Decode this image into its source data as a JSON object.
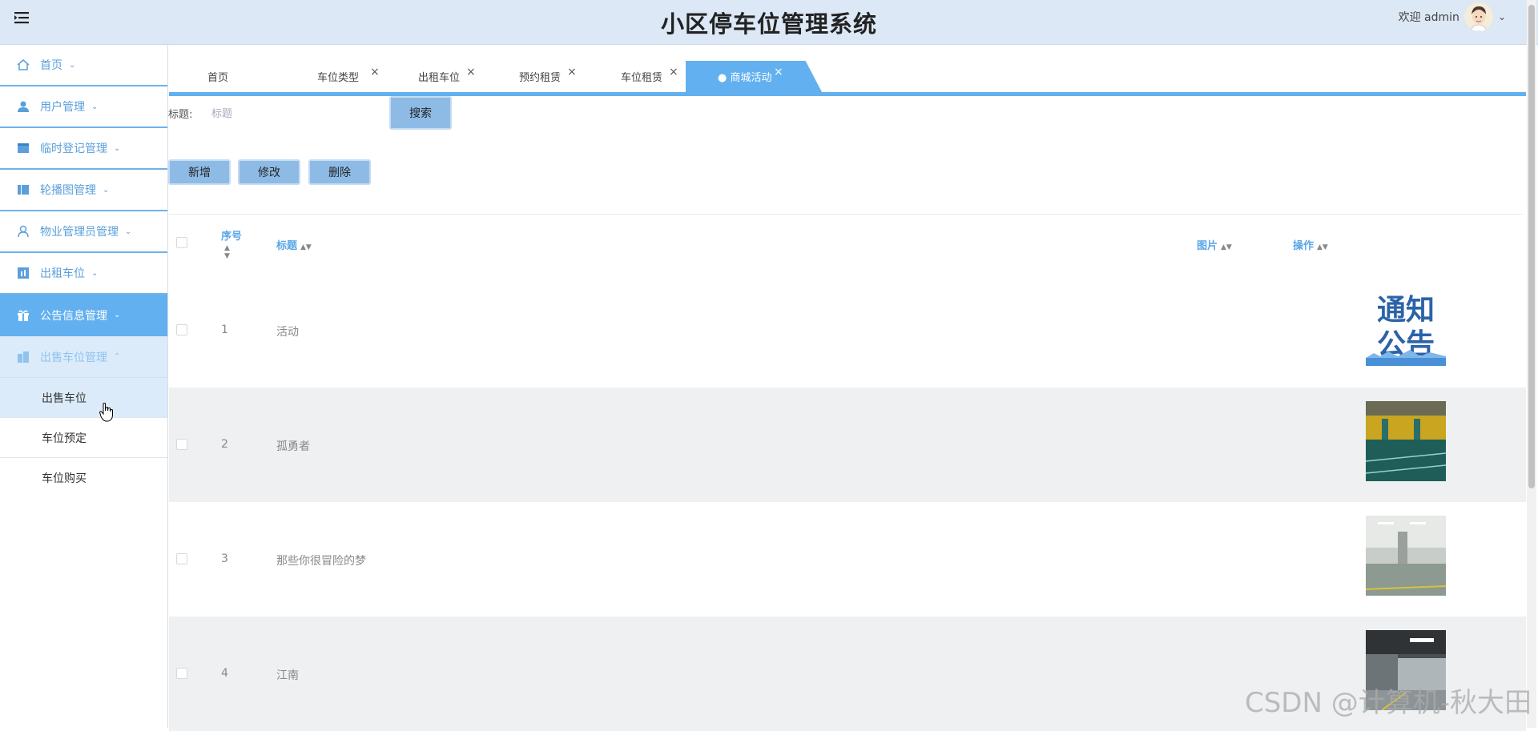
{
  "header": {
    "title": "小区停车位管理系统",
    "welcome": "欢迎 admin"
  },
  "sidebar": {
    "items": [
      {
        "label": "首页",
        "icon": "home-icon",
        "state": "normal"
      },
      {
        "label": "用户管理",
        "icon": "user-icon",
        "state": "normal"
      },
      {
        "label": "临时登记管理",
        "icon": "form-icon",
        "state": "normal"
      },
      {
        "label": "轮播图管理",
        "icon": "carousel-icon",
        "state": "normal"
      },
      {
        "label": "物业管理员管理",
        "icon": "person-outline-icon",
        "state": "normal"
      },
      {
        "label": "出租车位",
        "icon": "chart-icon",
        "state": "normal"
      },
      {
        "label": "公告信息管理",
        "icon": "gift-icon",
        "state": "active"
      },
      {
        "label": "出售车位管理",
        "icon": "building-icon",
        "state": "open"
      }
    ],
    "sub_items": [
      {
        "label": "出售车位"
      },
      {
        "label": "车位预定"
      },
      {
        "label": "车位购买"
      }
    ]
  },
  "tabs": [
    {
      "label": "首页",
      "closable": false
    },
    {
      "label": "车位类型",
      "closable": true
    },
    {
      "label": "出租车位",
      "closable": true
    },
    {
      "label": "预约租赁",
      "closable": true
    },
    {
      "label": "车位租赁",
      "closable": true
    },
    {
      "label": "● 商城活动",
      "closable": true,
      "active": true
    }
  ],
  "search": {
    "label": "标题:",
    "placeholder": "标题",
    "button": "搜索"
  },
  "actions": {
    "add": "新增",
    "edit": "修改",
    "delete": "删除"
  },
  "table": {
    "columns": [
      "序号",
      "标题",
      "图片",
      "操作"
    ],
    "rows": [
      {
        "index": "1",
        "title": "活动",
        "image": "notice-image"
      },
      {
        "index": "2",
        "title": "孤勇者",
        "image": "parking-garage-yellow-image"
      },
      {
        "index": "3",
        "title": "那些你很冒险的梦",
        "image": "parking-garage-bright-image"
      },
      {
        "index": "4",
        "title": "江南",
        "image": "parking-garage-dark-image"
      }
    ],
    "notice_image_text": [
      "通知",
      "公告"
    ]
  },
  "watermark": "CSDN @计算机-秋大田",
  "colors": {
    "accent": "#62b0ef",
    "header_bg": "#dce8f5",
    "button_bg": "#8dbbe6"
  }
}
